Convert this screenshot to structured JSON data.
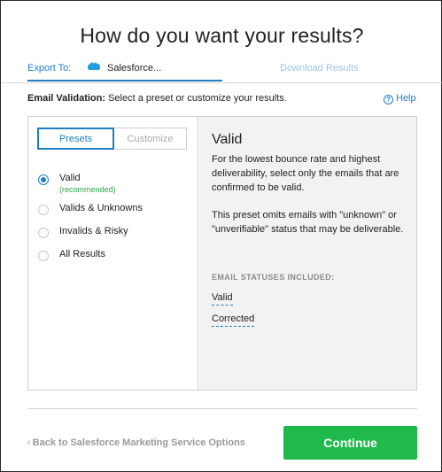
{
  "dialog": {
    "title": "How do you want your results?"
  },
  "tabs": {
    "export_label": "Export To:",
    "export_target": "Salesforce...",
    "download_label": "Download Results"
  },
  "email_validation": {
    "label": "Email Validation:",
    "instruction": "Select a preset or customize your results."
  },
  "help": {
    "label": "Help",
    "icon": "help-circle-icon"
  },
  "segmented": {
    "presets": "Presets",
    "customize": "Customize",
    "selected": "Presets"
  },
  "presets": {
    "selected": "Valid",
    "options": [
      {
        "label": "Valid",
        "note": "(recommended)"
      },
      {
        "label": "Valids & Unknowns"
      },
      {
        "label": "Invalids & Risky"
      },
      {
        "label": "All Results"
      }
    ]
  },
  "detail": {
    "title": "Valid",
    "description": "For the lowest bounce rate and highest deliverability, select only the emails that are confirmed to be valid.",
    "note": "This preset omits emails with \"unknown\" or \"unverifiable\" status that may be deliverable.",
    "statuses_heading": "EMAIL STATUSES INCLUDED:",
    "statuses": [
      "Valid",
      "Corrected"
    ]
  },
  "footer": {
    "back_label": "Back to Salesforce Marketing Service Options",
    "continue_label": "Continue"
  },
  "colors": {
    "accent": "#1f7fc0",
    "continue": "#1fb94c",
    "recommended": "#2aa84a",
    "disabled_tab": "#9cc6e6"
  }
}
